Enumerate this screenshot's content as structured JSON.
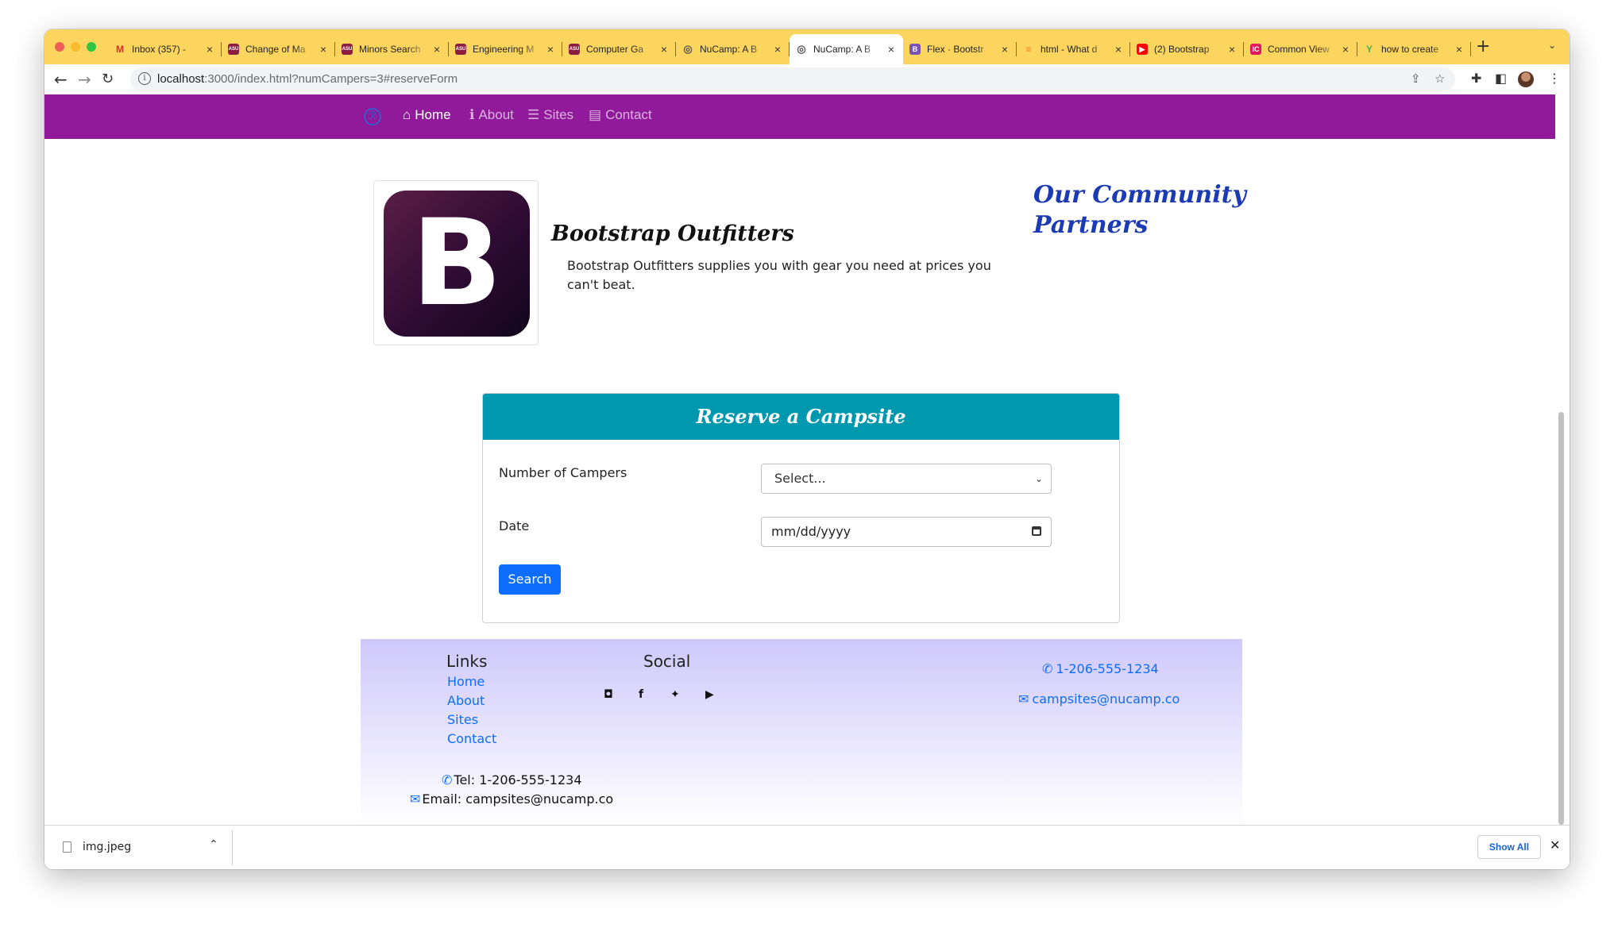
{
  "browser": {
    "tabs": [
      {
        "title": "Inbox (357) -",
        "icon": "gmail-icon",
        "icon_text": "M",
        "icon_color": "#d93025"
      },
      {
        "title": "Change of Ma",
        "icon": "asu-icon",
        "icon_text": "ASU",
        "icon_color": "#8c1d40"
      },
      {
        "title": "Minors Search",
        "icon": "asu-icon",
        "icon_text": "ASU",
        "icon_color": "#8c1d40"
      },
      {
        "title": "Engineering M",
        "icon": "asu-icon",
        "icon_text": "ASU",
        "icon_color": "#8c1d40"
      },
      {
        "title": "Computer Ga",
        "icon": "asu-icon",
        "icon_text": "ASU",
        "icon_color": "#8c1d40"
      },
      {
        "title": "NuCamp: A B",
        "icon": "globe-icon",
        "icon_text": "◎",
        "icon_color": "#555555"
      },
      {
        "title": "NuCamp: A B",
        "icon": "globe-icon",
        "icon_text": "◎",
        "icon_color": "#555555",
        "active": true
      },
      {
        "title": "Flex · Bootstr",
        "icon": "bootstrap-icon",
        "icon_text": "B",
        "icon_color": "#7952b3"
      },
      {
        "title": "html - What d",
        "icon": "stackoverflow-icon",
        "icon_text": "≡",
        "icon_color": "#f48024"
      },
      {
        "title": "(2) Bootstrap",
        "icon": "youtube-icon",
        "icon_text": "▶",
        "icon_color": "#ff0000"
      },
      {
        "title": "Common View",
        "icon": "jetbrains-icon",
        "icon_text": "IC",
        "icon_color": "#e3175c"
      },
      {
        "title": "how to create",
        "icon": "codegrepper-icon",
        "icon_text": "Y",
        "icon_color": "#4caf50"
      }
    ],
    "url_host": "localhost",
    "url_rest": ":3000/index.html?numCampers=3#reserveForm"
  },
  "navbar": {
    "home": "Home",
    "about": "About",
    "sites": "Sites",
    "contact": "Contact"
  },
  "jumbotron": {
    "logo_letter": "B",
    "title": "Bootstrap Outfitters",
    "description": "Bootstrap Outfitters supplies you with gear you need at prices you can't beat.",
    "partners_heading_line1": "Our Community",
    "partners_heading_line2": "Partners"
  },
  "reserve": {
    "header": "Reserve a Campsite",
    "campers_label": "Number of Campers",
    "campers_value": "Select...",
    "date_label": "Date",
    "date_placeholder": "mm/dd/yyyy",
    "search_button": "Search"
  },
  "footer": {
    "links_heading": "Links",
    "links": [
      "Home",
      "About",
      "Sites",
      "Contact"
    ],
    "social_heading": "Social",
    "phone_link": "1-206-555-1234",
    "email_link": "campsites@nucamp.co",
    "tel_line": "Tel: 1-206-555-1234",
    "email_line": "Email: campsites@nucamp.co"
  },
  "download_shelf": {
    "file_name": "img.jpeg",
    "show_all": "Show All"
  },
  "colors": {
    "navbar_bg": "#911a9a",
    "card_header_bg": "#0098ae",
    "primary": "#0d6efd",
    "tabstrip_bg": "#fcd55e"
  }
}
